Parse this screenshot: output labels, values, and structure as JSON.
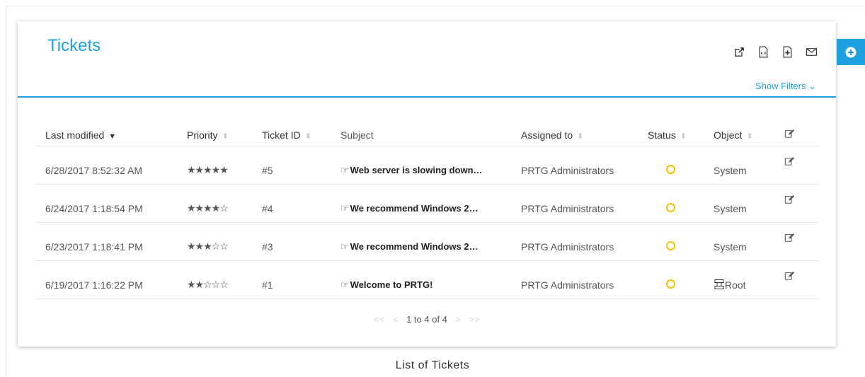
{
  "panel": {
    "title": "Tickets",
    "show_filters": "Show Filters ⌄",
    "header_icons": [
      "external-link-icon",
      "code-icon",
      "add-document-icon",
      "email-icon"
    ]
  },
  "table": {
    "columns": {
      "last_modified": "Last modified",
      "priority": "Priority",
      "ticket_id": "Ticket ID",
      "subject": "Subject",
      "assigned_to": "Assigned to",
      "status": "Status",
      "object": "Object"
    },
    "rows": [
      {
        "last_modified": "6/28/2017 8:52:32 AM",
        "priority": "★★★★★",
        "ticket_id": "#5",
        "subject": "Web server is slowing down…",
        "assigned_to": "PRTG Administrators",
        "object": "System"
      },
      {
        "last_modified": "6/24/2017 1:18:54 PM",
        "priority": "★★★★☆",
        "ticket_id": "#4",
        "subject": "We recommend Windows 2…",
        "assigned_to": "PRTG Administrators",
        "object": "System"
      },
      {
        "last_modified": "6/23/2017 1:18:41 PM",
        "priority": "★★★☆☆",
        "ticket_id": "#3",
        "subject": "We recommend Windows 2…",
        "assigned_to": "PRTG Administrators",
        "object": "System"
      },
      {
        "last_modified": "6/19/2017 1:16:22 PM",
        "priority": "★★☆☆☆",
        "ticket_id": "#1",
        "subject": "Welcome to PRTG!",
        "assigned_to": "PRTG Administrators",
        "object": "Root"
      }
    ]
  },
  "pagination": {
    "first": "<<",
    "prev": "<",
    "text": "1 to 4 of 4",
    "next": ">",
    "last": ">>"
  },
  "caption": "List of Tickets",
  "colors": {
    "accent": "#1da1e0",
    "status_unknown": "#f5c200"
  }
}
